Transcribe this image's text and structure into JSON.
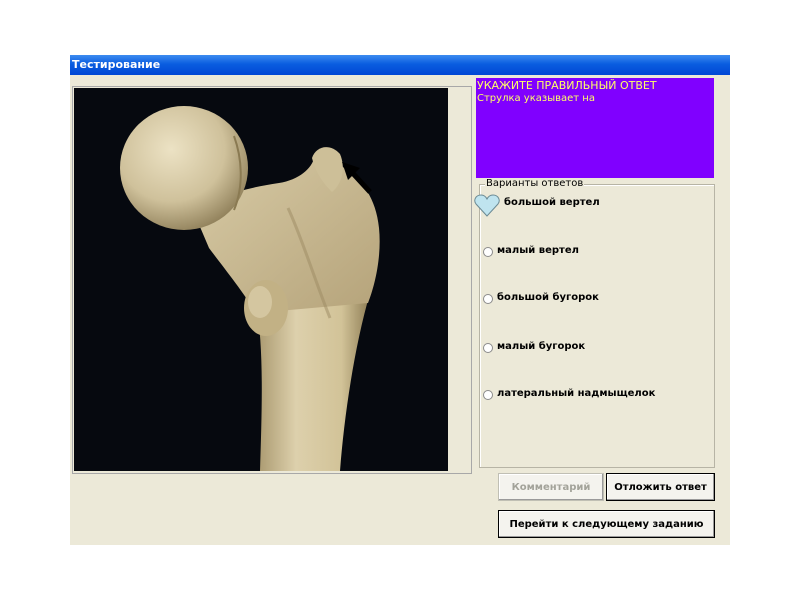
{
  "window": {
    "title": "Тестирование"
  },
  "task": {
    "heading": "УКАЖИТЕ ПРАВИЛЬНЫЙ ОТВЕТ",
    "question": "Струлка указывает на"
  },
  "answers": {
    "legend": "Варианты ответов",
    "options": [
      {
        "label": "большой вертел",
        "selected": true
      },
      {
        "label": "малый вертел",
        "selected": false
      },
      {
        "label": "большой бугорок",
        "selected": false
      },
      {
        "label": "малый бугорок",
        "selected": false
      },
      {
        "label": "латеральный надмыщелок",
        "selected": false
      }
    ]
  },
  "buttons": {
    "comment": "Комментарий",
    "postpone": "Отложить ответ",
    "next": "Перейти к следующему заданию"
  },
  "colors": {
    "task_panel": "#8000ff",
    "task_text": "#ffff66",
    "title_bar": "#0a5de0",
    "window_bg": "#ece9d8"
  },
  "icons": {
    "selection_marker": "heart-icon"
  }
}
